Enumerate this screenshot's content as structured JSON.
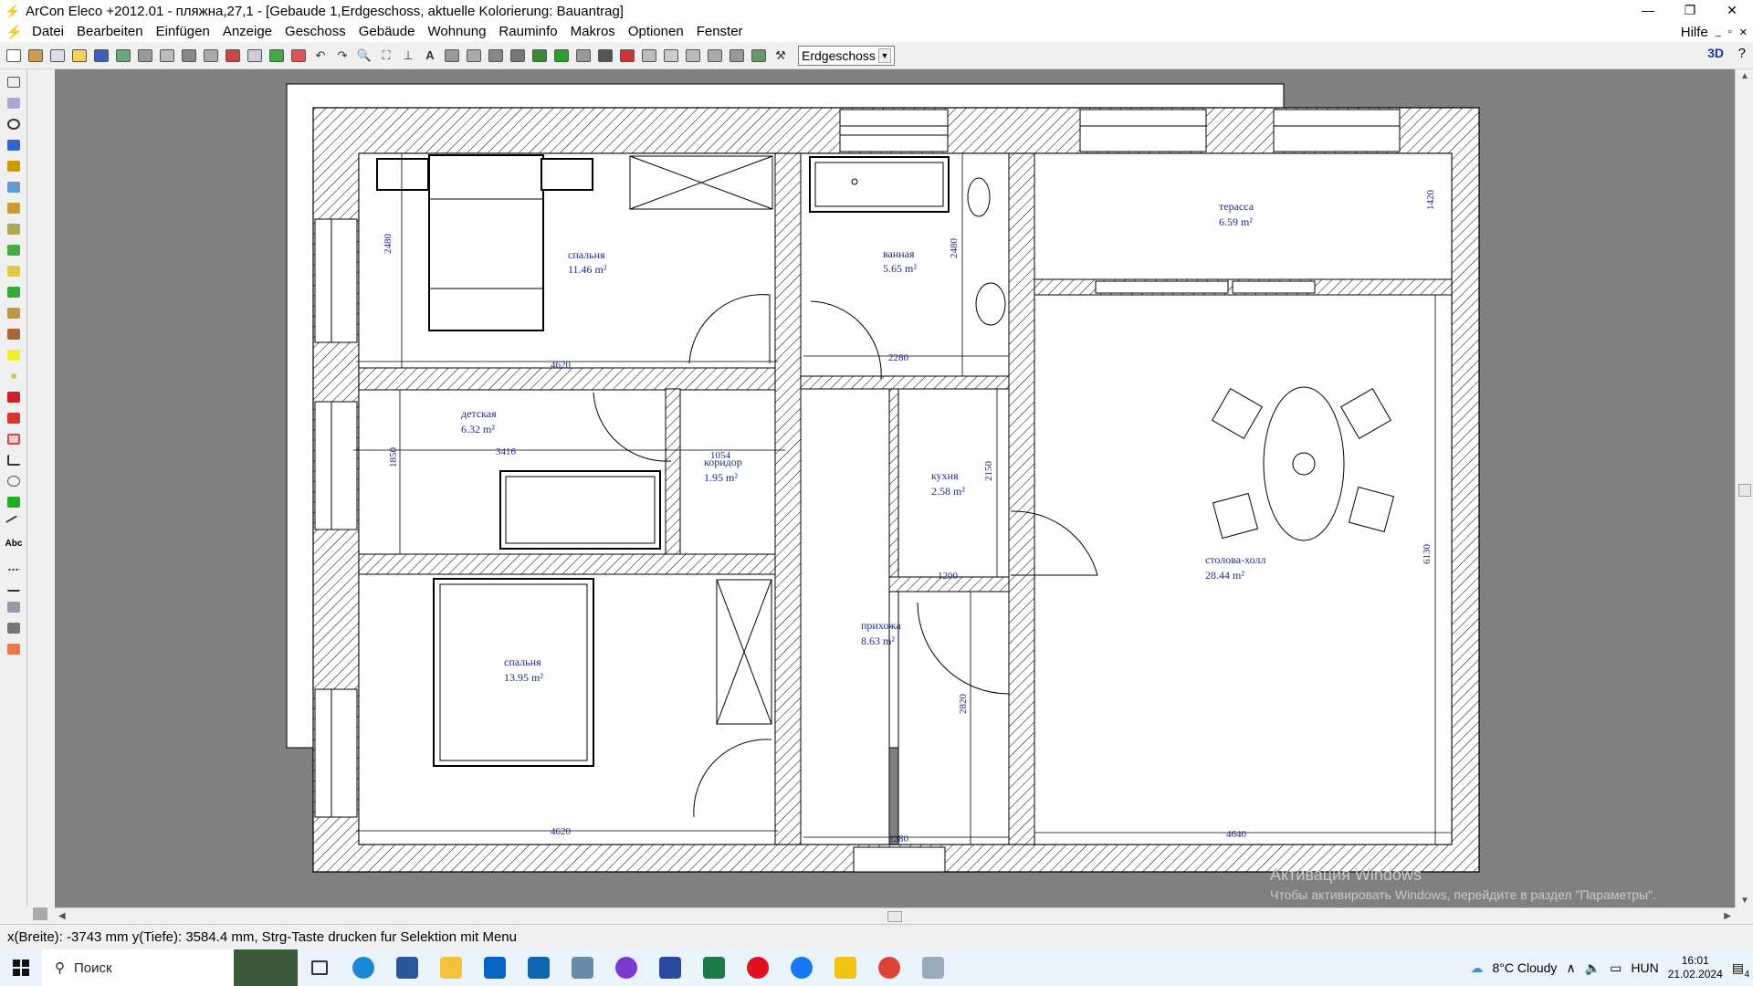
{
  "window": {
    "title": "ArCon Eleco  +2012.01  - пляжна,27,1 - [Gebaude 1,Erdgeschoss, aktuelle Kolorierung: Bauantrag]",
    "controls": [
      "—",
      "❐",
      "✕"
    ]
  },
  "menu": {
    "items": [
      "Datei",
      "Bearbeiten",
      "Einfügen",
      "Anzeige",
      "Geschoss",
      "Gebäude",
      "Wohnung",
      "Rauminfo",
      "Makros",
      "Optionen",
      "Fenster"
    ],
    "help": "Hilfe"
  },
  "toolbar": {
    "floor_select": "Erdgeschoss",
    "label_3d": "3D",
    "help_icon": "?"
  },
  "plan": {
    "rooms": [
      {
        "name": "спальня",
        "area": "11.46 m²"
      },
      {
        "name": "ванная",
        "area": "5.65 m²"
      },
      {
        "name": "тераcса",
        "area": "6.59 m²"
      },
      {
        "name": "детская",
        "area": "6.32 m²"
      },
      {
        "name": "коридор",
        "area": "1.95 m²"
      },
      {
        "name": "кухня",
        "area": "2.58 m²"
      },
      {
        "name": "столова-холл",
        "area": "28.44 m²"
      },
      {
        "name": "прихожа",
        "area": "8.63 m²"
      },
      {
        "name": "спальня",
        "area": "13.95 m²"
      }
    ],
    "dimensions": [
      "2480",
      "4620",
      "2480",
      "2280",
      "1420",
      "1850",
      "3416",
      "1054",
      "2150",
      "1200",
      "6130",
      "2820",
      "4620",
      "2280",
      "4640"
    ]
  },
  "status": {
    "text": "x(Breite): -3743 mm  y(Tiefe): 3584.4 mm, Strg-Taste drucken fur Selektion mit Menu"
  },
  "taskbar": {
    "search_placeholder": "Поиск",
    "weather": "8°C  Cloudy",
    "language": "HUN",
    "time": "16:01",
    "date": "21.02.2024",
    "notifications": "4"
  },
  "watermark": {
    "line1": "Активация Windows",
    "line2": "Чтобы активировать Windows, перейдите в раздел \"Параметры\"."
  }
}
